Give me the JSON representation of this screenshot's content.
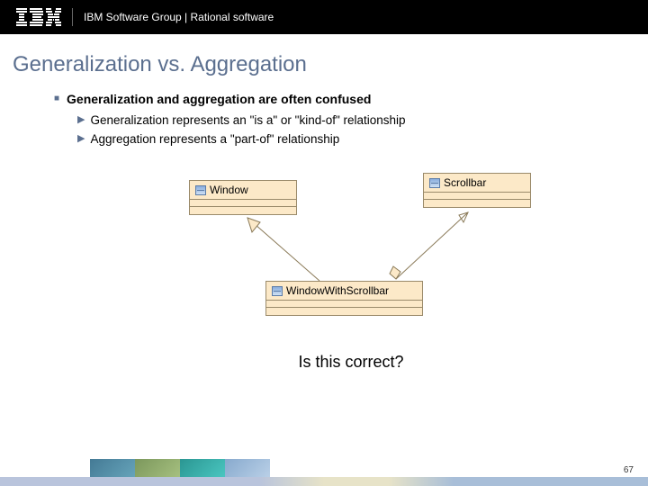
{
  "header": {
    "text": "IBM Software Group | Rational software"
  },
  "title": "Generalization vs. Aggregation",
  "bullets": {
    "main": "Generalization and aggregation are often confused",
    "sub1": "Generalization represents an \"is a\" or \"kind-of\" relationship",
    "sub2": "Aggregation represents a \"part-of\" relationship"
  },
  "uml": {
    "window": "Window",
    "scrollbar": "Scrollbar",
    "child": "WindowWithScrollbar"
  },
  "question": "Is this correct?",
  "page": "67"
}
